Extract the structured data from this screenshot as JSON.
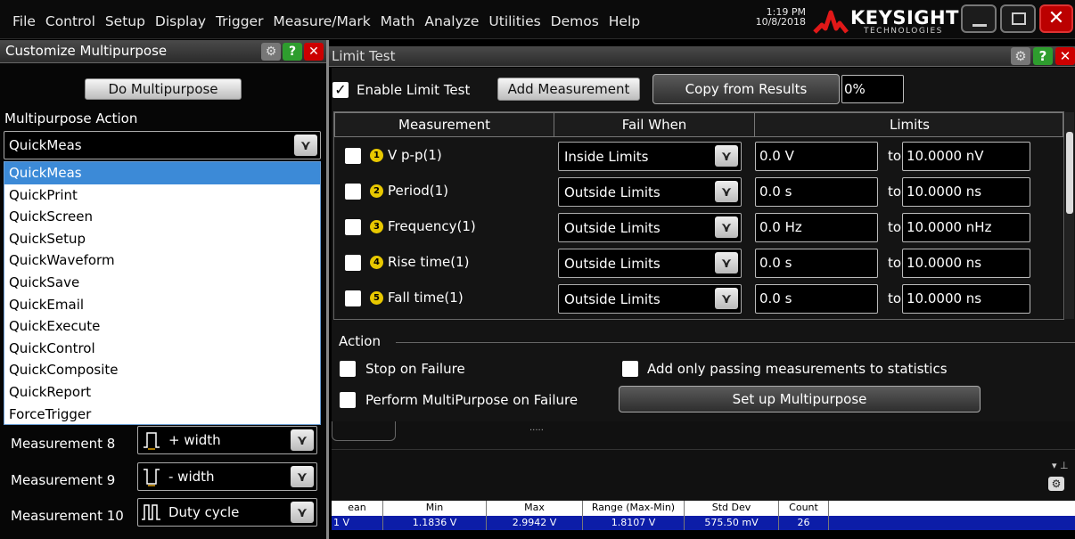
{
  "menubar": {
    "items": [
      "File",
      "Control",
      "Setup",
      "Display",
      "Trigger",
      "Measure/Mark",
      "Math",
      "Analyze",
      "Utilities",
      "Demos",
      "Help"
    ],
    "time": "1:19 PM",
    "date": "10/8/2018",
    "brand": "KEYSIGHT",
    "brand_sub": "TECHNOLOGIES"
  },
  "customize": {
    "title": "Customize Multipurpose",
    "do_button": "Do Multipurpose",
    "action_label": "Multipurpose Action",
    "selected": "QuickMeas",
    "options": [
      "QuickMeas",
      "QuickPrint",
      "QuickScreen",
      "QuickSetup",
      "QuickWaveform",
      "QuickSave",
      "QuickEmail",
      "QuickExecute",
      "QuickControl",
      "QuickComposite",
      "QuickReport",
      "ForceTrigger"
    ],
    "measurements": [
      {
        "label": "Measurement 8",
        "value": "+ width"
      },
      {
        "label": "Measurement 9",
        "value": "- width"
      },
      {
        "label": "Measurement 10",
        "value": "Duty cycle"
      }
    ]
  },
  "limit_test": {
    "title": "Limit Test",
    "enable_label": "Enable Limit Test",
    "enabled": true,
    "add_button": "Add Measurement",
    "copy_button": "Copy from Results",
    "percent": "0%",
    "headers": [
      "Measurement",
      "Fail When",
      "Limits"
    ],
    "rows": [
      {
        "num": "1",
        "name": "V p-p(1)",
        "fail": "Inside Limits",
        "low": "0.0 V",
        "to": "to",
        "high": "10.0000 nV"
      },
      {
        "num": "2",
        "name": "Period(1)",
        "fail": "Outside Limits",
        "low": "0.0 s",
        "to": "to",
        "high": "10.0000 ns"
      },
      {
        "num": "3",
        "name": "Frequency(1)",
        "fail": "Outside Limits",
        "low": "0.0 Hz",
        "to": "to",
        "high": "10.0000 nHz"
      },
      {
        "num": "4",
        "name": "Rise time(1)",
        "fail": "Outside Limits",
        "low": "0.0 s",
        "to": "to",
        "high": "10.0000 ns"
      },
      {
        "num": "5",
        "name": "Fall time(1)",
        "fail": "Outside Limits",
        "low": "0.0 s",
        "to": "to",
        "high": "10.0000 ns"
      }
    ],
    "action_label": "Action",
    "stop_on_failure": "Stop on Failure",
    "add_passing": "Add only passing measurements to statistics",
    "perform_mp": "Perform MultiPurpose on Failure",
    "setup_mp_button": "Set up Multipurpose"
  },
  "stats": {
    "headers": [
      "ean",
      "Min",
      "Max",
      "Range (Max-Min)",
      "Std Dev",
      "Count"
    ],
    "row": [
      "1 V",
      "1.1836 V",
      "2.9942 V",
      "1.8107 V",
      "575.50 mV",
      "26"
    ]
  },
  "colors": {
    "accent_select": "#3c8ad7",
    "stats_row": "#0c1da8",
    "close": "#cc0000",
    "help": "#2e9d2e",
    "marker": "#e8c800"
  }
}
